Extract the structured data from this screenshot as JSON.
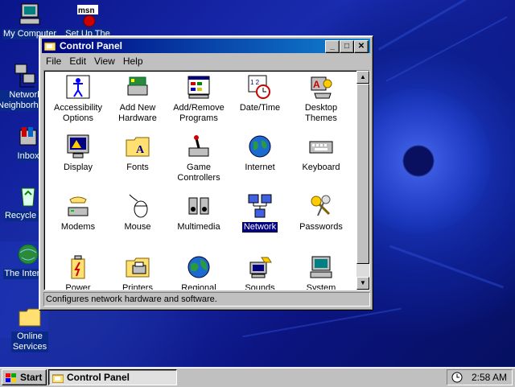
{
  "desktop": {
    "icons": [
      {
        "label": "My Computer",
        "icon": "my-computer-icon"
      },
      {
        "label": "Network Neighborhood",
        "icon": "network-neighborhood-icon"
      },
      {
        "label": "Inbox",
        "icon": "inbox-icon"
      },
      {
        "label": "Recycle Bin",
        "icon": "recycle-bin-icon"
      },
      {
        "label": "The Internet",
        "icon": "internet-icon"
      },
      {
        "label": "Online Services",
        "icon": "folder-icon"
      },
      {
        "label": "Set Up The",
        "icon": "msn-icon"
      }
    ]
  },
  "window": {
    "title": "Control Panel",
    "menus": [
      "File",
      "Edit",
      "View",
      "Help"
    ],
    "items": [
      {
        "label": "Accessibility Options",
        "icon": "accessibility-icon"
      },
      {
        "label": "Add New Hardware",
        "icon": "add-hardware-icon"
      },
      {
        "label": "Add/Remove Programs",
        "icon": "add-remove-programs-icon"
      },
      {
        "label": "Date/Time",
        "icon": "calendar-clock-icon"
      },
      {
        "label": "Desktop Themes",
        "icon": "desktop-themes-icon"
      },
      {
        "label": "Display",
        "icon": "display-icon"
      },
      {
        "label": "Fonts",
        "icon": "fonts-folder-icon"
      },
      {
        "label": "Game Controllers",
        "icon": "joystick-icon"
      },
      {
        "label": "Internet",
        "icon": "globe-icon"
      },
      {
        "label": "Keyboard",
        "icon": "keyboard-icon"
      },
      {
        "label": "Modems",
        "icon": "modem-phone-icon"
      },
      {
        "label": "Mouse",
        "icon": "mouse-icon"
      },
      {
        "label": "Multimedia",
        "icon": "speaker-icon"
      },
      {
        "label": "Network",
        "icon": "network-icon"
      },
      {
        "label": "Passwords",
        "icon": "keys-icon"
      },
      {
        "label": "Power",
        "icon": "battery-icon"
      },
      {
        "label": "Printers",
        "icon": "printer-folder-icon"
      },
      {
        "label": "Regional",
        "icon": "globe-icon"
      },
      {
        "label": "Sounds",
        "icon": "speaker-computer-icon"
      },
      {
        "label": "System",
        "icon": "computer-icon"
      }
    ],
    "selected_item": "Network",
    "status_text": "Configures network hardware and software."
  },
  "taskbar": {
    "start_label": "Start",
    "task_label": "Control Panel",
    "clock": "2:58 AM"
  },
  "colors": {
    "titlebar": "#000080",
    "desktop": "#0a1a8a",
    "face": "#c0c0c0"
  }
}
